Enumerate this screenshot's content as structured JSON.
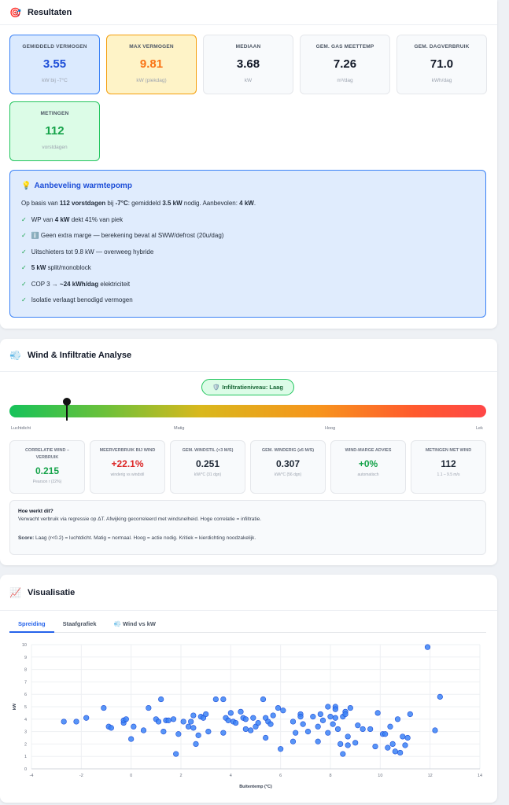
{
  "results": {
    "title": "Resultaten",
    "icon": "target-icon",
    "stats": [
      {
        "label": "GEMIDDELD VERMOGEN",
        "value": "3.55",
        "unit": "kW bij -7°C",
        "style": "blue"
      },
      {
        "label": "MAX VERMOGEN",
        "value": "9.81",
        "unit": "kW (piekdag)",
        "style": "orange"
      },
      {
        "label": "MEDIAAN",
        "value": "3.68",
        "unit": "kW",
        "style": ""
      },
      {
        "label": "GEM. GAS MEETTEMP",
        "value": "7.26",
        "unit": "m³/dag",
        "style": ""
      },
      {
        "label": "GEM. DAGVERBRUIK",
        "value": "71.0",
        "unit": "kWh/dag",
        "style": ""
      },
      {
        "label": "METINGEN",
        "value": "112",
        "unit": "vorstdagen",
        "style": "green"
      }
    ],
    "advice": {
      "title": "Aanbeveling warmtepomp",
      "intro": {
        "p1": "Op basis van ",
        "b1": "112 vorstdagen",
        "p2": " bij ",
        "b2": "-7°C",
        "p3": ": gemiddeld ",
        "b3": "3.5 kW",
        "p4": " nodig. Aanbevolen: ",
        "b4": "4 kW",
        "p5": "."
      },
      "items": [
        {
          "pre": "WP van ",
          "bold": "4 kW",
          "post": " dekt 41% van piek"
        },
        {
          "pre": "ℹ️ Geen extra marge — berekening bevat al SWW/defrost (20u/dag)",
          "bold": "",
          "post": ""
        },
        {
          "pre": "Uitschieters tot 9.8 kW — overweeg hybride",
          "bold": "",
          "post": ""
        },
        {
          "pre": "",
          "bold": "5 kW",
          "post": " split/monoblock"
        },
        {
          "pre": "COP 3 → ",
          "bold": "~24 kWh/dag",
          "post": " elektriciteit"
        },
        {
          "pre": "Isolatie verlaagt benodigd vermogen",
          "bold": "",
          "post": ""
        }
      ]
    }
  },
  "wind": {
    "title": "Wind & Infiltratie Analyse",
    "badge": "Infiltratieniveau: Laag",
    "level_fraction": 0.12,
    "scale": [
      "Luchtdicht",
      "Matig",
      "Hoog",
      "Lek"
    ],
    "stats": [
      {
        "label": "CORRELATIE WIND – VERBRUIK",
        "value": "0.215",
        "sub": "Pearson r (22%)",
        "color": "green"
      },
      {
        "label": "MEERVERBRUIK BIJ WIND",
        "value": "+22.1%",
        "sub": "winderig vs windstil",
        "color": "red"
      },
      {
        "label": "GEM. WINDSTIL (<3 M/S)",
        "value": "0.251",
        "sub": "kW/°C (31 dgn)",
        "color": ""
      },
      {
        "label": "GEM. WINDERIG (≥5 M/S)",
        "value": "0.307",
        "sub": "kW/°C (56 dgn)",
        "color": ""
      },
      {
        "label": "WIND-MARGE ADVIES",
        "value": "+0%",
        "sub": "automatisch",
        "color": "green"
      },
      {
        "label": "METINGEN MET WIND",
        "value": "112",
        "sub": "1.1 – 9.5 m/s",
        "color": ""
      }
    ],
    "explain": {
      "heading": "Hoe werkt dit?",
      "text": "Verwacht verbruik via regressie op ΔT. Afwijking gecorreleerd met windsnelheid. Hoge correlatie = infiltratie.",
      "score_label": "Score:",
      "score_text": " Laag (r<0.2) = luchtdicht. Matig = normaal. Hoog = actie nodig. Kritiek = kierdichting noodzakelijk."
    }
  },
  "vis": {
    "title": "Visualisatie",
    "tabs": [
      {
        "label": "Spreiding",
        "active": true
      },
      {
        "label": "Staafgrafiek",
        "active": false
      },
      {
        "label": "💨 Wind vs kW",
        "active": false
      }
    ]
  },
  "chart_data": {
    "type": "scatter",
    "xlabel": "Buitentemp (°C)",
    "ylabel": "kW",
    "xlim": [
      -4,
      14
    ],
    "ylim": [
      0,
      10
    ],
    "xticks": [
      -4,
      -2,
      0,
      2,
      4,
      6,
      8,
      10,
      12,
      14
    ],
    "yticks": [
      0,
      1,
      2,
      3,
      4,
      5,
      6,
      7,
      8,
      9,
      10
    ],
    "color": "#3b82f6",
    "grid": true,
    "points": [
      [
        -2.7,
        3.8
      ],
      [
        -2.2,
        3.8
      ],
      [
        -1.8,
        4.1
      ],
      [
        -1.1,
        4.9
      ],
      [
        -0.9,
        3.4
      ],
      [
        -0.8,
        3.3
      ],
      [
        -0.3,
        3.7
      ],
      [
        -0.3,
        3.9
      ],
      [
        -0.2,
        4.0
      ],
      [
        0.0,
        2.4
      ],
      [
        0.1,
        3.4
      ],
      [
        0.5,
        3.1
      ],
      [
        0.7,
        4.9
      ],
      [
        1.0,
        4.0
      ],
      [
        1.1,
        3.8
      ],
      [
        1.2,
        5.6
      ],
      [
        1.3,
        3.0
      ],
      [
        1.4,
        3.9
      ],
      [
        1.5,
        3.9
      ],
      [
        1.7,
        4.0
      ],
      [
        1.8,
        1.2
      ],
      [
        1.9,
        2.8
      ],
      [
        2.1,
        3.8
      ],
      [
        2.3,
        3.4
      ],
      [
        2.4,
        3.8
      ],
      [
        2.5,
        4.3
      ],
      [
        2.5,
        3.3
      ],
      [
        2.6,
        2.0
      ],
      [
        2.7,
        2.7
      ],
      [
        2.8,
        4.2
      ],
      [
        2.9,
        4.1
      ],
      [
        3.0,
        4.4
      ],
      [
        3.1,
        3.0
      ],
      [
        3.4,
        5.6
      ],
      [
        3.7,
        5.6
      ],
      [
        3.7,
        2.9
      ],
      [
        3.8,
        4.1
      ],
      [
        3.9,
        3.9
      ],
      [
        4.0,
        4.5
      ],
      [
        4.1,
        3.8
      ],
      [
        4.2,
        3.7
      ],
      [
        4.4,
        4.6
      ],
      [
        4.5,
        4.1
      ],
      [
        4.6,
        3.2
      ],
      [
        4.6,
        4.0
      ],
      [
        4.8,
        3.1
      ],
      [
        4.9,
        4.1
      ],
      [
        5.0,
        3.4
      ],
      [
        5.1,
        3.7
      ],
      [
        5.3,
        5.6
      ],
      [
        5.4,
        2.5
      ],
      [
        5.4,
        4.1
      ],
      [
        5.5,
        3.8
      ],
      [
        5.6,
        3.6
      ],
      [
        5.7,
        4.3
      ],
      [
        5.9,
        4.9
      ],
      [
        6.0,
        1.6
      ],
      [
        6.1,
        4.7
      ],
      [
        6.5,
        3.8
      ],
      [
        6.5,
        2.2
      ],
      [
        6.6,
        2.9
      ],
      [
        6.8,
        4.4
      ],
      [
        6.8,
        4.2
      ],
      [
        6.9,
        3.6
      ],
      [
        7.1,
        3.0
      ],
      [
        7.3,
        4.2
      ],
      [
        7.5,
        2.2
      ],
      [
        7.5,
        3.4
      ],
      [
        7.6,
        4.4
      ],
      [
        7.7,
        3.9
      ],
      [
        7.9,
        5.0
      ],
      [
        7.9,
        2.9
      ],
      [
        8.0,
        4.2
      ],
      [
        8.1,
        3.6
      ],
      [
        8.2,
        5.0
      ],
      [
        8.2,
        4.8
      ],
      [
        8.2,
        4.1
      ],
      [
        8.3,
        3.2
      ],
      [
        8.4,
        2.0
      ],
      [
        8.5,
        4.2
      ],
      [
        8.5,
        1.2
      ],
      [
        8.6,
        4.6
      ],
      [
        8.6,
        4.4
      ],
      [
        8.7,
        2.6
      ],
      [
        8.7,
        1.9
      ],
      [
        8.8,
        4.9
      ],
      [
        9.0,
        2.1
      ],
      [
        9.1,
        3.5
      ],
      [
        9.3,
        3.2
      ],
      [
        9.6,
        3.2
      ],
      [
        9.8,
        1.8
      ],
      [
        9.9,
        4.5
      ],
      [
        10.1,
        2.8
      ],
      [
        10.2,
        2.8
      ],
      [
        10.3,
        1.7
      ],
      [
        10.4,
        3.4
      ],
      [
        10.5,
        2.0
      ],
      [
        10.6,
        1.4
      ],
      [
        10.7,
        4.0
      ],
      [
        10.8,
        1.3
      ],
      [
        10.9,
        2.6
      ],
      [
        11.0,
        1.9
      ],
      [
        11.1,
        2.5
      ],
      [
        11.2,
        4.4
      ],
      [
        11.9,
        9.8
      ],
      [
        12.2,
        3.1
      ],
      [
        12.4,
        5.8
      ]
    ]
  }
}
